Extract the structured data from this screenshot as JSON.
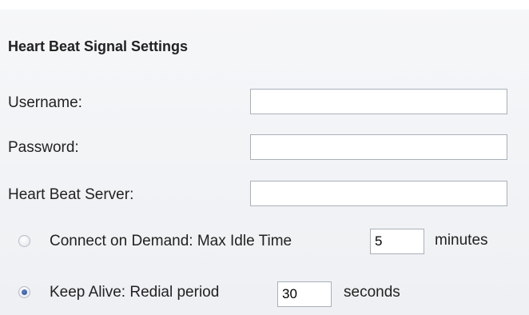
{
  "section": {
    "title": "Heart Beat Signal Settings"
  },
  "fields": {
    "username": {
      "label": "Username:",
      "value": ""
    },
    "password": {
      "label": "Password:",
      "value": ""
    },
    "server": {
      "label": "Heart Beat Server:",
      "value": ""
    }
  },
  "connect_on_demand": {
    "label": "Connect on Demand: Max Idle Time",
    "value": "5",
    "unit": "minutes",
    "selected": false
  },
  "keep_alive": {
    "label": "Keep Alive: Redial period",
    "value": "30",
    "unit": "seconds",
    "selected": true
  }
}
